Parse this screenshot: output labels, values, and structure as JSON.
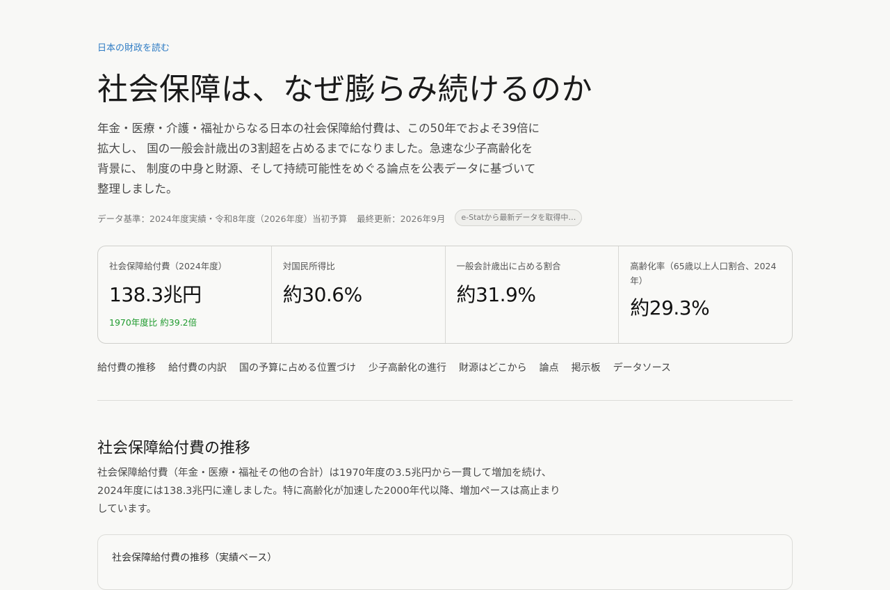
{
  "header": {
    "eyebrow": "日本の財政を読む",
    "title": "社会保障は、なぜ膨らみ続けるのか",
    "lead": "年金・医療・介護・福祉からなる日本の社会保障給付費は、この50年でおよそ39倍に拡大し、 国の一般会計歳出の3割超を占めるまでになりました。急速な少子高齢化を背景に、 制度の中身と財源、そして持続可能性をめぐる論点を公表データに基づいて整理しました。",
    "meta_basis": "データ基準：2024年度実績・令和8年度（2026年度）当初予算",
    "meta_updated": "最終更新：2026年9月",
    "badge": "e-Statから最新データを取得中…"
  },
  "stats": [
    {
      "label": "社会保障給付費（2024年度）",
      "value": "138.3兆円",
      "note": "1970年度比 約39.2倍"
    },
    {
      "label": "対国民所得比",
      "value": "約30.6%"
    },
    {
      "label": "一般会計歳出に占める割合",
      "value": "約31.9%"
    },
    {
      "label": "高齢化率（65歳以上人口割合、2024年）",
      "value": "約29.3%"
    }
  ],
  "nav": [
    "給付費の推移",
    "給付費の内訳",
    "国の予算に占める位置づけ",
    "少子高齢化の進行",
    "財源はどこから",
    "論点",
    "掲示板",
    "データソース"
  ],
  "section": {
    "title": "社会保障給付費の推移",
    "body": "社会保障給付費（年金・医療・福祉その他の合計）は1970年度の3.5兆円から一貫して増加を続け、2024年度には138.3兆円に達しました。特に高齢化が加速した2000年代以降、増加ペースは高止まりしています。",
    "chart_title": "社会保障給付費の推移（実績ベース）"
  },
  "colors": {
    "accent": "#2f7cc4",
    "positive": "#1f9a2e"
  }
}
